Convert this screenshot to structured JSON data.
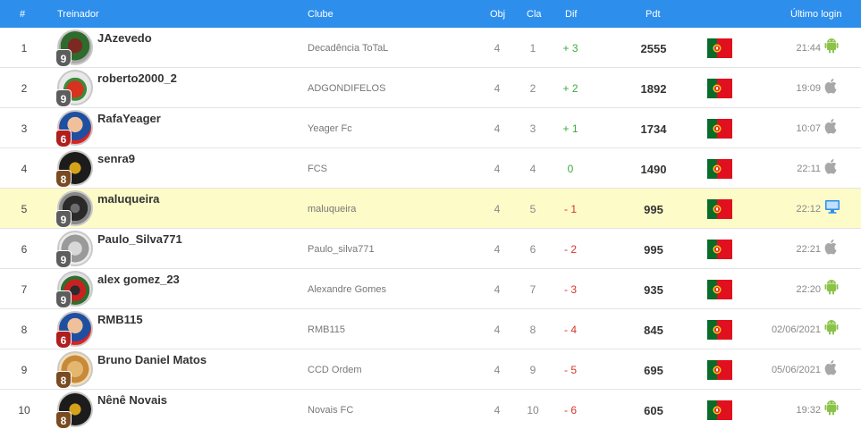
{
  "header": {
    "pos": "#",
    "trainer": "Treinador",
    "club": "Clube",
    "obj": "Obj",
    "cla": "Cla",
    "dif": "Dif",
    "pdt": "Pdt",
    "last_login": "Último login"
  },
  "rows": [
    {
      "pos": "1",
      "name": "JAzevedo",
      "level": "9",
      "club": "Decadência ToTaL",
      "obj": "4",
      "cla": "1",
      "dif": "+ 3",
      "pdt": "2555",
      "login": "21:44",
      "device": "android-icon"
    },
    {
      "pos": "2",
      "name": "roberto2000_2",
      "level": "9",
      "club": "ADGONDIFELOS",
      "obj": "4",
      "cla": "2",
      "dif": "+ 2",
      "pdt": "1892",
      "login": "19:09",
      "device": "apple-icon"
    },
    {
      "pos": "3",
      "name": "RafaYeager",
      "level": "6",
      "club": "Yeager Fc",
      "obj": "4",
      "cla": "3",
      "dif": "+ 1",
      "pdt": "1734",
      "login": "10:07",
      "device": "apple-icon"
    },
    {
      "pos": "4",
      "name": "senra9",
      "level": "8",
      "club": "FCS",
      "obj": "4",
      "cla": "4",
      "dif": "0",
      "pdt": "1490",
      "login": "22:11",
      "device": "apple-icon"
    },
    {
      "pos": "5",
      "name": "maluqueira",
      "level": "9",
      "club": "maluqueira",
      "obj": "4",
      "cla": "5",
      "dif": "- 1",
      "pdt": "995",
      "login": "22:12",
      "device": "desktop-icon"
    },
    {
      "pos": "6",
      "name": "Paulo_Silva771",
      "level": "9",
      "club": "Paulo_silva771",
      "obj": "4",
      "cla": "6",
      "dif": "- 2",
      "pdt": "995",
      "login": "22:21",
      "device": "apple-icon"
    },
    {
      "pos": "7",
      "name": "alex gomez_23",
      "level": "9",
      "club": "Alexandre Gomes",
      "obj": "4",
      "cla": "7",
      "dif": "- 3",
      "pdt": "935",
      "login": "22:20",
      "device": "android-icon"
    },
    {
      "pos": "8",
      "name": "RMB115",
      "level": "6",
      "club": "RMB115",
      "obj": "4",
      "cla": "8",
      "dif": "- 4",
      "pdt": "845",
      "login": "02/06/2021",
      "device": "android-icon"
    },
    {
      "pos": "9",
      "name": "Bruno Daniel Matos",
      "level": "8",
      "club": "CCD Ordem",
      "obj": "4",
      "cla": "9",
      "dif": "- 5",
      "pdt": "695",
      "login": "05/06/2021",
      "device": "apple-icon"
    },
    {
      "pos": "10",
      "name": "Nênê Novais",
      "level": "8",
      "club": "Novais FC",
      "obj": "4",
      "cla": "10",
      "dif": "- 6",
      "pdt": "605",
      "login": "19:32",
      "device": "android-icon"
    }
  ],
  "colors": {
    "header_bg": "#2d8eeb",
    "highlight_row": "#fdfbc8",
    "positive": "#3daa3d",
    "negative": "#d8342c",
    "android": "#8bc34a",
    "apple": "#a8a8a8",
    "desktop": "#2d8eeb"
  }
}
